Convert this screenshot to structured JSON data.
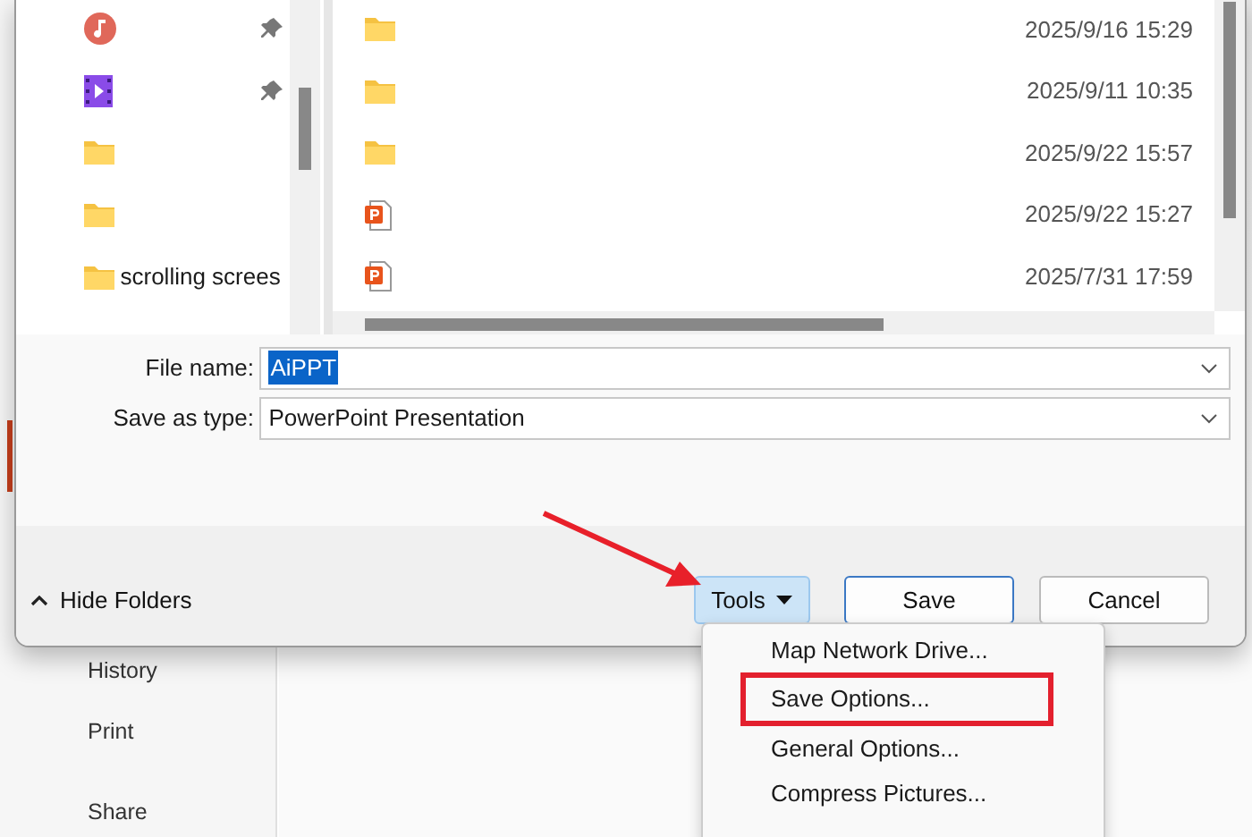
{
  "background_nav": [
    {
      "label": "History"
    },
    {
      "label": "Print"
    },
    {
      "label": "Share"
    }
  ],
  "dialog": {
    "nav_items": [
      {
        "kind": "music",
        "pinned": true
      },
      {
        "kind": "video",
        "pinned": true
      },
      {
        "kind": "folder",
        "pinned": false
      },
      {
        "kind": "folder",
        "pinned": false
      },
      {
        "kind": "folder",
        "pinned": false,
        "label": "scrolling screes"
      }
    ],
    "files": [
      {
        "kind": "folder",
        "modified": "2025/9/16 15:29"
      },
      {
        "kind": "folder",
        "modified": "2025/9/11 10:35"
      },
      {
        "kind": "folder",
        "modified": "2025/9/22 15:57"
      },
      {
        "kind": "pptx",
        "modified": "2025/9/22 15:27"
      },
      {
        "kind": "pptx",
        "modified": "2025/7/31 17:59"
      }
    ],
    "file_name": {
      "label": "File name:",
      "value": "AiPPT",
      "text_selected": true
    },
    "save_as_type": {
      "label": "Save as type:",
      "value": "PowerPoint Presentation"
    },
    "hide_folders": "Hide Folders",
    "tools_button": {
      "label": "Tools",
      "expanded": true
    },
    "buttons": [
      "Save",
      "Cancel"
    ]
  },
  "tools_menu": [
    {
      "label": "Map Network Drive...",
      "highlighted": false
    },
    {
      "label": "Save Options...",
      "highlighted": true
    },
    {
      "label": "General Options...",
      "highlighted": false
    },
    {
      "label": "Compress Pictures...",
      "highlighted": false
    }
  ]
}
